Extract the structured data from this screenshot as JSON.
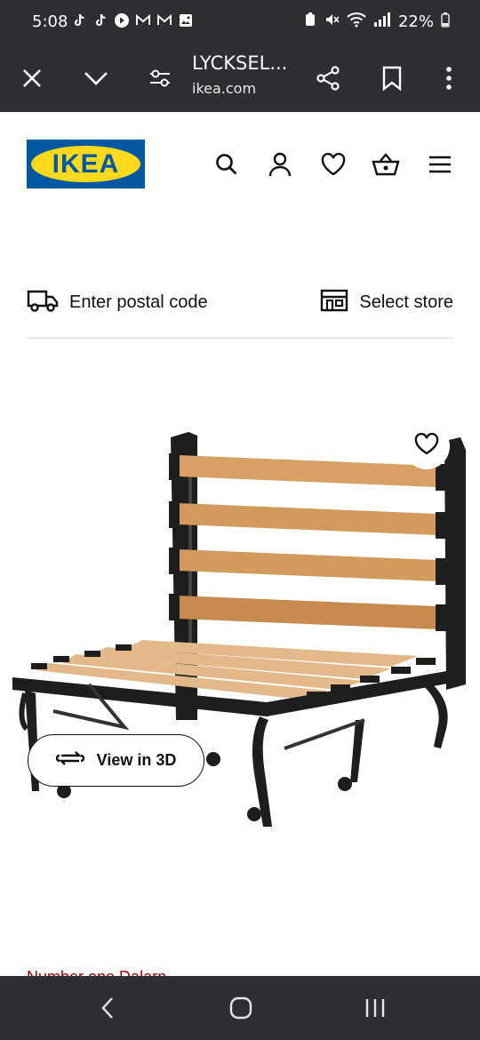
{
  "status_bar": {
    "time": "5:08",
    "battery": "22%"
  },
  "browser": {
    "title": "LYCKSEL...",
    "url": "ikea.com"
  },
  "site": {
    "logo_text": "IKEA",
    "logo_colors": {
      "blue": "#0058a3",
      "yellow": "#ffda1a"
    }
  },
  "delivery": {
    "postal_label": "Enter postal code",
    "store_label": "Select store"
  },
  "product": {
    "view_3d_label": "View in 3D",
    "cut_text": "Number one Dalarn"
  },
  "icons": {
    "header": [
      "search-icon",
      "account-icon",
      "heart-icon",
      "basket-icon",
      "menu-icon"
    ],
    "navbar": [
      "back-icon",
      "home-icon",
      "recents-icon"
    ]
  }
}
